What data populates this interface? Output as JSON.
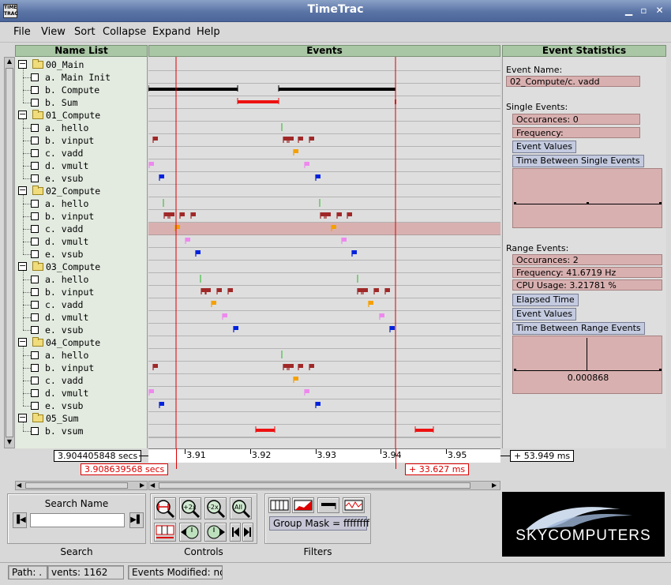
{
  "window": {
    "title": "TimeTrac",
    "icon_text": "TIME TRAC"
  },
  "menu": [
    "File",
    "View",
    "Sort",
    "Collapse",
    "Expand",
    "Help"
  ],
  "headers": {
    "names": "Name List",
    "events": "Events",
    "stats": "Event Statistics"
  },
  "tree": [
    {
      "type": "group",
      "label": "00_Main"
    },
    {
      "type": "item",
      "label": "a. Main Init"
    },
    {
      "type": "item",
      "label": "b. Compute"
    },
    {
      "type": "item",
      "label": "b. Sum"
    },
    {
      "type": "group",
      "label": "01_Compute"
    },
    {
      "type": "item",
      "label": "a. hello"
    },
    {
      "type": "item",
      "label": "b. vinput"
    },
    {
      "type": "item",
      "label": "c. vadd"
    },
    {
      "type": "item",
      "label": "d. vmult"
    },
    {
      "type": "item",
      "label": "e. vsub"
    },
    {
      "type": "group",
      "label": "02_Compute"
    },
    {
      "type": "item",
      "label": "a. hello"
    },
    {
      "type": "item",
      "label": "b. vinput"
    },
    {
      "type": "item",
      "label": "c. vadd"
    },
    {
      "type": "item",
      "label": "d. vmult"
    },
    {
      "type": "item",
      "label": "e. vsub"
    },
    {
      "type": "group",
      "label": "03_Compute"
    },
    {
      "type": "item",
      "label": "a. hello"
    },
    {
      "type": "item",
      "label": "b. vinput"
    },
    {
      "type": "item",
      "label": "c. vadd"
    },
    {
      "type": "item",
      "label": "d. vmult"
    },
    {
      "type": "item",
      "label": "e. vsub"
    },
    {
      "type": "group",
      "label": "04_Compute"
    },
    {
      "type": "item",
      "label": "a. hello"
    },
    {
      "type": "item",
      "label": "b. vinput"
    },
    {
      "type": "item",
      "label": "c. vadd"
    },
    {
      "type": "item",
      "label": "d. vmult"
    },
    {
      "type": "item",
      "label": "e. vsub"
    },
    {
      "type": "group",
      "label": "05_Sum"
    },
    {
      "type": "item",
      "label": "b. vsum"
    }
  ],
  "stats": {
    "event_name_label": "Event Name:",
    "event_name": "02_Compute/c. vadd",
    "single_label": "Single Events:",
    "single_occurances": "Occurances: 0",
    "single_frequency": "Frequency:",
    "btn_event_values": "Event Values",
    "btn_time_between_single": "Time Between Single Events",
    "range_label": "Range Events:",
    "range_occurances": "Occurances: 2",
    "range_frequency": "Frequency: 41.6719 Hz",
    "range_cpu": "CPU Usage: 3.21781 %",
    "btn_elapsed": "Elapsed Time",
    "btn_event_values2": "Event Values",
    "btn_time_between_range": "Time Between Range Events",
    "plot_value": "0.000868"
  },
  "axis": {
    "start_time": "3.904405848 secs",
    "cursor_time": "3.908639568 secs",
    "cursor_delta": "+ 33.627 ms",
    "span": "+ 53.949 ms",
    "ticks": [
      "3.91",
      "3.92",
      "3.93",
      "3.94",
      "3.95"
    ]
  },
  "search": {
    "label": "Search Name",
    "caption": "Search",
    "value": ""
  },
  "controls": {
    "caption": "Controls"
  },
  "filters": {
    "caption": "Filters",
    "group_mask": "Group Mask = ffffffff"
  },
  "logo": {
    "text": "SKYCOMPUTERS"
  },
  "status": {
    "path": "Path: .",
    "events": "vents: 1162",
    "modified": "Events Modified: no"
  },
  "colors": {
    "hello": "#22bb22",
    "vinput": "#a02828",
    "vadd": "#f5a000",
    "vmult": "#ee88ee",
    "vsub": "#0022dd",
    "range": "#ee1111",
    "cursor": "#dd0000",
    "selected_row": "#d9b0b0"
  }
}
